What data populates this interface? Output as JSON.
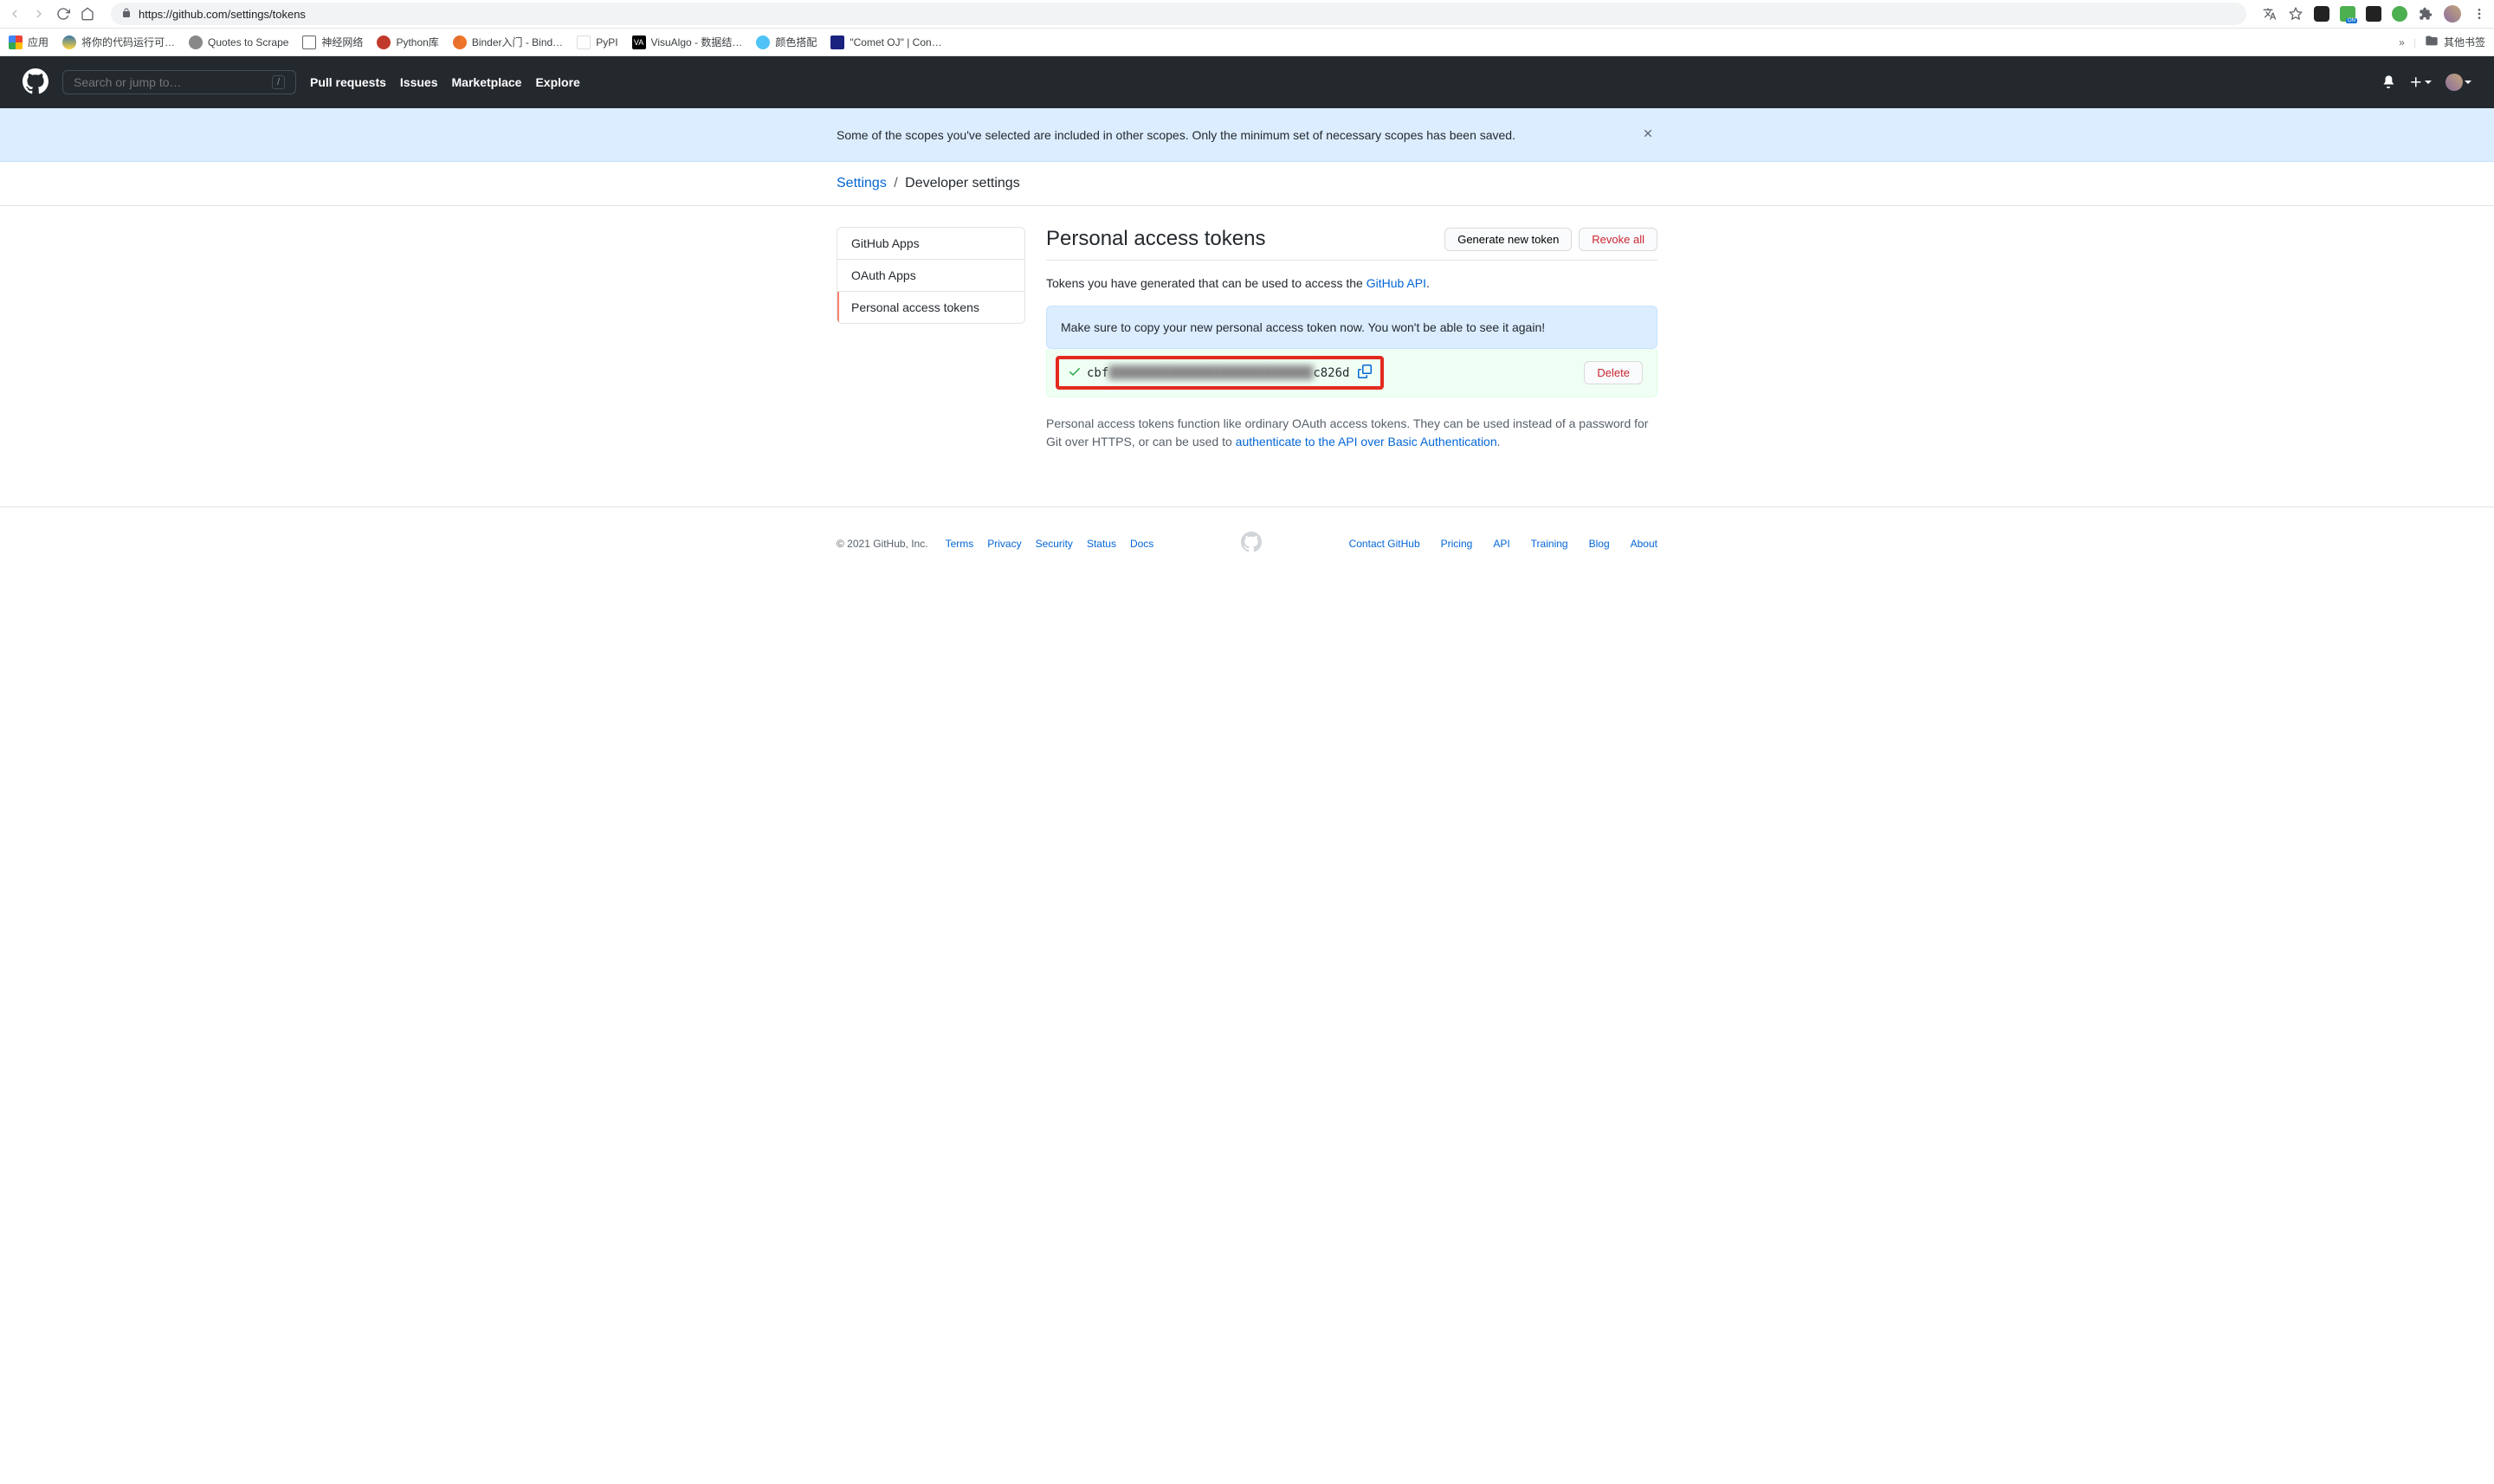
{
  "browser": {
    "url": "https://github.com/settings/tokens",
    "bookmarks_label_apps": "应用",
    "bookmarks": [
      "将你的代码运行可…",
      "Quotes to Scrape",
      "神经网络",
      "Python库",
      "Binder入门 - Bind…",
      "PyPI",
      "VisuAlgo - 数据结…",
      "颜色搭配",
      "\"Comet OJ\" | Con…"
    ],
    "other_bookmarks": "其他书签"
  },
  "header": {
    "search_placeholder": "Search or jump to…",
    "slash_key": "/",
    "nav": [
      "Pull requests",
      "Issues",
      "Marketplace",
      "Explore"
    ]
  },
  "flash": {
    "text": "Some of the scopes you've selected are included in other scopes. Only the minimum set of necessary scopes has been saved."
  },
  "breadcrumb": {
    "settings": "Settings",
    "sep": "/",
    "current": "Developer settings"
  },
  "sidebar": {
    "items": [
      "GitHub Apps",
      "OAuth Apps",
      "Personal access tokens"
    ]
  },
  "page": {
    "title": "Personal access tokens",
    "generate_btn": "Generate new token",
    "revoke_btn": "Revoke all",
    "intro_prefix": "Tokens you have generated that can be used to access the ",
    "intro_link": "GitHub API",
    "intro_suffix": ".",
    "info_box": "Make sure to copy your new personal access token now. You won't be able to see it again!",
    "token_prefix": "cbf",
    "token_blur": "████████████████████████████",
    "token_suffix": "c826d",
    "delete_btn": "Delete",
    "desc_1": "Personal access tokens function like ordinary OAuth access tokens. They can be used instead of a password for Git over HTTPS, or can be used to ",
    "desc_link": "authenticate to the API over Basic Authentication",
    "desc_2": "."
  },
  "footer": {
    "copyright": "© 2021 GitHub, Inc.",
    "left_links": [
      "Terms",
      "Privacy",
      "Security",
      "Status",
      "Docs"
    ],
    "right_links": [
      "Contact GitHub",
      "Pricing",
      "API",
      "Training",
      "Blog",
      "About"
    ]
  }
}
